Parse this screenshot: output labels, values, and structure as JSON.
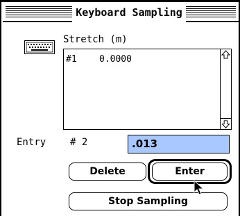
{
  "window": {
    "title": "Keyboard Sampling"
  },
  "list": {
    "column_header": "Stretch (m)",
    "rows": [
      {
        "index": "#1",
        "value": "0.0000"
      }
    ]
  },
  "entry": {
    "label": "Entry",
    "number": "# 2",
    "value": ".013"
  },
  "buttons": {
    "delete": "Delete",
    "enter": "Enter",
    "stop": "Stop Sampling"
  },
  "icons": {
    "keyboard": "keyboard-icon",
    "scroll_up": "scroll-up-arrow-icon",
    "scroll_down": "scroll-down-arrow-icon",
    "cursor": "arrow-cursor-icon"
  },
  "colors": {
    "field_highlight": "#a8c8ff"
  }
}
